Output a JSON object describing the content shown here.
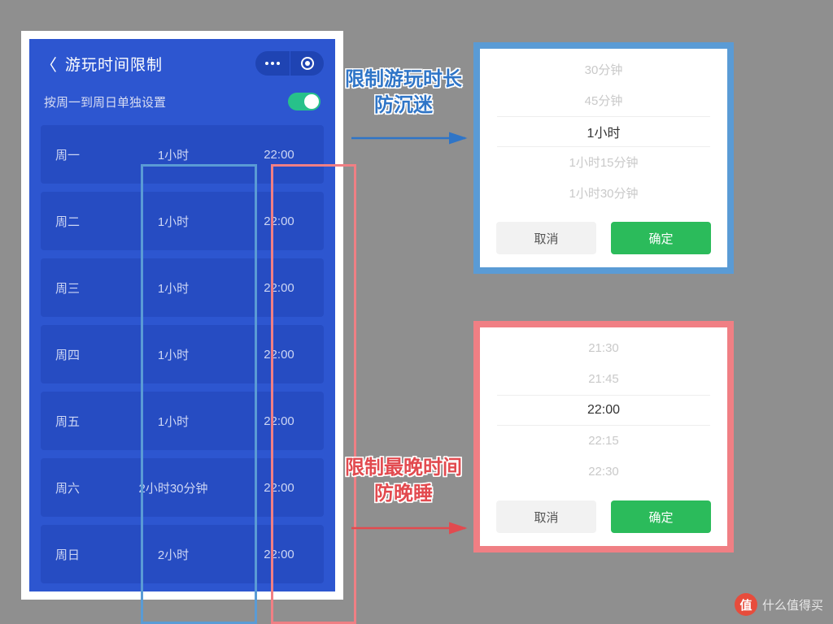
{
  "phone": {
    "title": "游玩时间限制",
    "toggle_label": "按周一到周日单独设置",
    "days": [
      {
        "name": "周一",
        "dur": "1小时",
        "time": "22:00"
      },
      {
        "name": "周二",
        "dur": "1小时",
        "time": "22:00"
      },
      {
        "name": "周三",
        "dur": "1小时",
        "time": "22:00"
      },
      {
        "name": "周四",
        "dur": "1小时",
        "time": "22:00"
      },
      {
        "name": "周五",
        "dur": "1小时",
        "time": "22:00"
      },
      {
        "name": "周六",
        "dur": "2小时30分钟",
        "time": "22:00"
      },
      {
        "name": "周日",
        "dur": "2小时",
        "time": "22:00"
      }
    ]
  },
  "annotations": {
    "duration": {
      "l1": "限制游玩时长",
      "l2": "防沉迷"
    },
    "latest": {
      "l1": "限制最晚时间",
      "l2": "防晚睡"
    }
  },
  "picker_duration": {
    "options": [
      "30分钟",
      "45分钟",
      "1小时",
      "1小时15分钟",
      "1小时30分钟"
    ],
    "selected_index": 2,
    "cancel_label": "取消",
    "ok_label": "确定"
  },
  "picker_time": {
    "options": [
      "21:30",
      "21:45",
      "22:00",
      "22:15",
      "22:30"
    ],
    "selected_index": 2,
    "cancel_label": "取消",
    "ok_label": "确定"
  },
  "watermark": {
    "badge": "值",
    "text": "什么值得买"
  },
  "colors": {
    "primary_blue": "#2d56d0",
    "highlight_blue": "#5a9bd5",
    "highlight_red": "#f07f84",
    "switch_green": "#27c18a",
    "ok_green": "#2bbb5b"
  }
}
